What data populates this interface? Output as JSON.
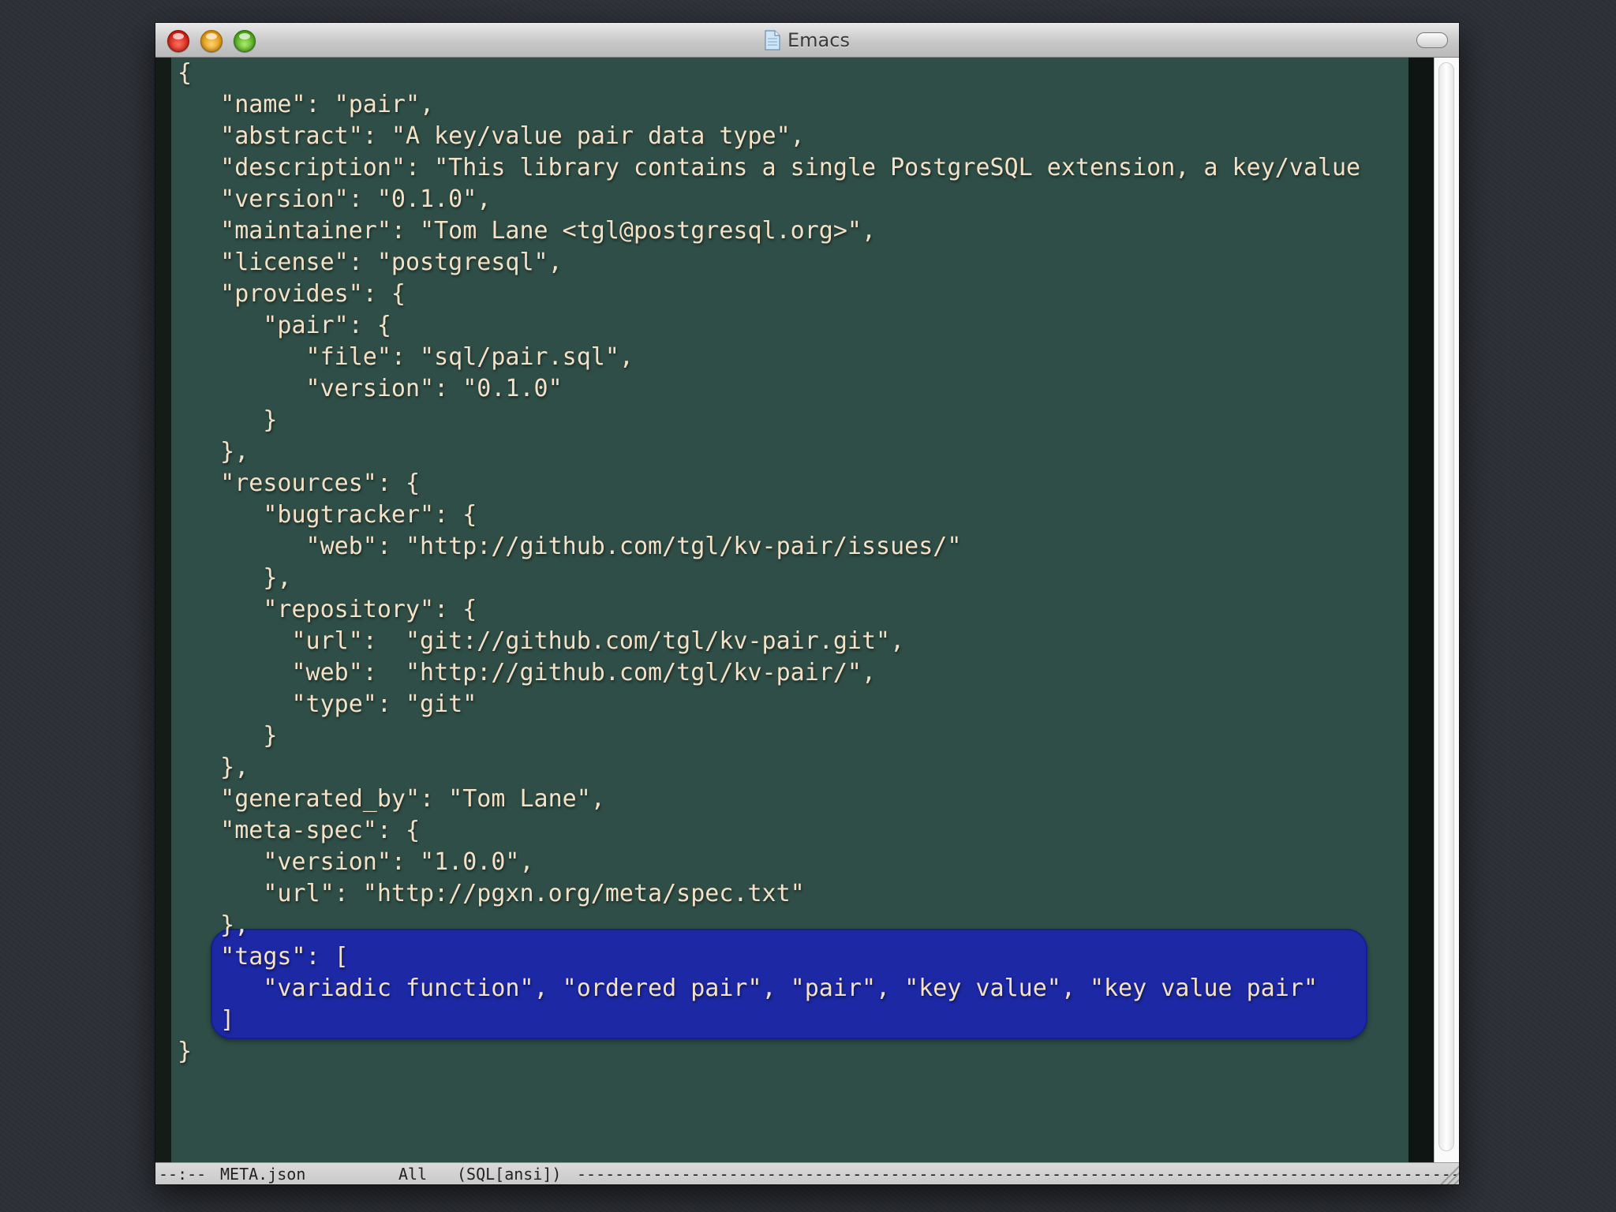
{
  "window": {
    "title": "Emacs",
    "title_icon": "document-icon",
    "colors": {
      "editor_bg": "#2f4e47",
      "code_text": "#f4e1c6",
      "highlight": "#1c28a4"
    }
  },
  "editor": {
    "lines": [
      "{",
      "   \"name\": \"pair\",",
      "   \"abstract\": \"A key/value pair data type\",",
      "   \"description\": \"This library contains a single PostgreSQL extension, a key/value",
      "   \"version\": \"0.1.0\",",
      "   \"maintainer\": \"Tom Lane <tgl@postgresql.org>\",",
      "   \"license\": \"postgresql\",",
      "   \"provides\": {",
      "      \"pair\": {",
      "         \"file\": \"sql/pair.sql\",",
      "         \"version\": \"0.1.0\"",
      "      }",
      "   },",
      "   \"resources\": {",
      "      \"bugtracker\": {",
      "         \"web\": \"http://github.com/tgl/kv-pair/issues/\"",
      "      },",
      "      \"repository\": {",
      "        \"url\":  \"git://github.com/tgl/kv-pair.git\",",
      "        \"web\":  \"http://github.com/tgl/kv-pair/\",",
      "        \"type\": \"git\"",
      "      }",
      "   },",
      "   \"generated_by\": \"Tom Lane\",",
      "   \"meta-spec\": {",
      "      \"version\": \"1.0.0\",",
      "      \"url\": \"http://pgxn.org/meta/spec.txt\"",
      "   },",
      "   \"tags\": [",
      "      \"variadic function\", \"ordered pair\", \"pair\", \"key value\", \"key value pair\"",
      "   ]",
      "}"
    ],
    "highlighted_lines": [
      28,
      29,
      30
    ]
  },
  "modeline": {
    "status": "--:--",
    "buffer_name": "META.json",
    "position": "All",
    "mode": "(SQL[ansi])",
    "trailer": "----------------------------------------------------------------------------------------------"
  }
}
